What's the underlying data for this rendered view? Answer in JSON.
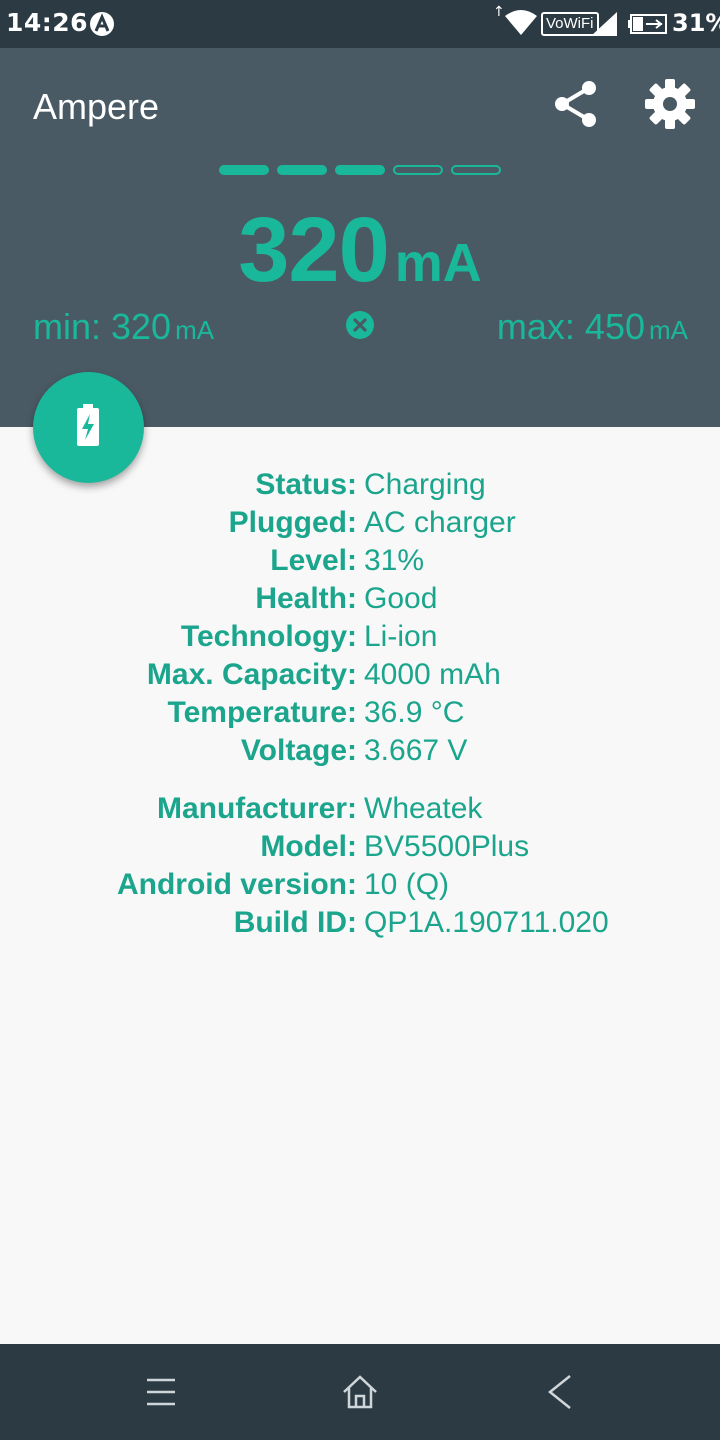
{
  "status_bar": {
    "time": "14:26",
    "network_label": "VoWiFi",
    "battery_percent": "31%",
    "icons": [
      "a-badge-icon",
      "upload-arrow-icon",
      "wifi-icon",
      "signal-icon",
      "battery-charging-icon"
    ]
  },
  "app": {
    "title": "Ampere",
    "actions": [
      "share-icon",
      "settings-icon"
    ]
  },
  "meter": {
    "current_value": "320",
    "current_unit": "mA",
    "level_indicator": {
      "filled": 3,
      "total": 5
    },
    "min_label": "min: 320",
    "min_unit": "mA",
    "max_label": "max: 450",
    "max_unit": "mA"
  },
  "battery_info": [
    {
      "label": "Status:",
      "value": "Charging"
    },
    {
      "label": "Plugged:",
      "value": "AC charger"
    },
    {
      "label": "Level:",
      "value": "31%"
    },
    {
      "label": "Health:",
      "value": "Good"
    },
    {
      "label": "Technology:",
      "value": "Li-ion"
    },
    {
      "label": "Max. Capacity:",
      "value": "4000 mAh"
    },
    {
      "label": "Temperature:",
      "value": "36.9 °C"
    },
    {
      "label": "Voltage:",
      "value": "3.667 V"
    }
  ],
  "device_info": [
    {
      "label": "Manufacturer:",
      "value": "Wheatek"
    },
    {
      "label": "Model:",
      "value": "BV5500Plus"
    },
    {
      "label": "Android version:",
      "value": "10 (Q)"
    },
    {
      "label": "Build ID:",
      "value": "QP1A.190711.020"
    }
  ],
  "colors": {
    "accent": "#1ab89a",
    "header_bg": "#4a5a65",
    "statusbar_bg": "#2c3a43",
    "content_bg": "#f8f8f8"
  }
}
